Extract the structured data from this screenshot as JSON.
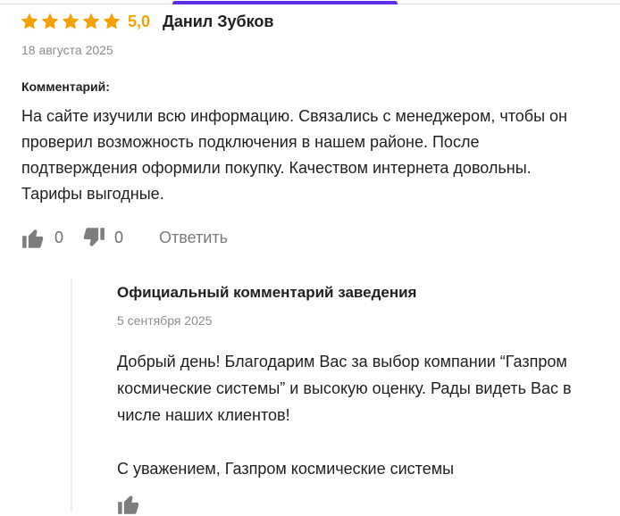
{
  "colors": {
    "star": "#f6a100",
    "rating": "#f6a100",
    "accent": "#5b2ee6",
    "muted_text": "#8c8c8c",
    "icon": "#7d7d7d"
  },
  "review": {
    "rating": "5,0",
    "stars_filled": 5,
    "stars_total": 5,
    "author": "Данил Зубков",
    "date": "18 августа 2025",
    "comment_label": "Комментарий:",
    "text": "На сайте изучили всю информацию. Связались с менеджером, чтобы он проверил возможность подключения в нашем районе. После подтверждения оформили покупку. Качеством интернета довольны. Тарифы выгодные.",
    "likes": "0",
    "dislikes": "0",
    "reply_label": "Ответить",
    "icons": {
      "star": "star-icon",
      "like": "thumbs-up-icon",
      "dislike": "thumbs-down-icon"
    }
  },
  "official_reply": {
    "title": "Официальный комментарий заведения",
    "date": "5 сентября 2025",
    "paragraph_1": "Добрый день! Благодарим Вас за выбор компании “Газпром космические системы” и высокую оценку. Рады видеть Вас в числе наших клиентов!",
    "signature": "С уважением, Газпром космические системы",
    "like_icon": "thumbs-up-icon"
  }
}
